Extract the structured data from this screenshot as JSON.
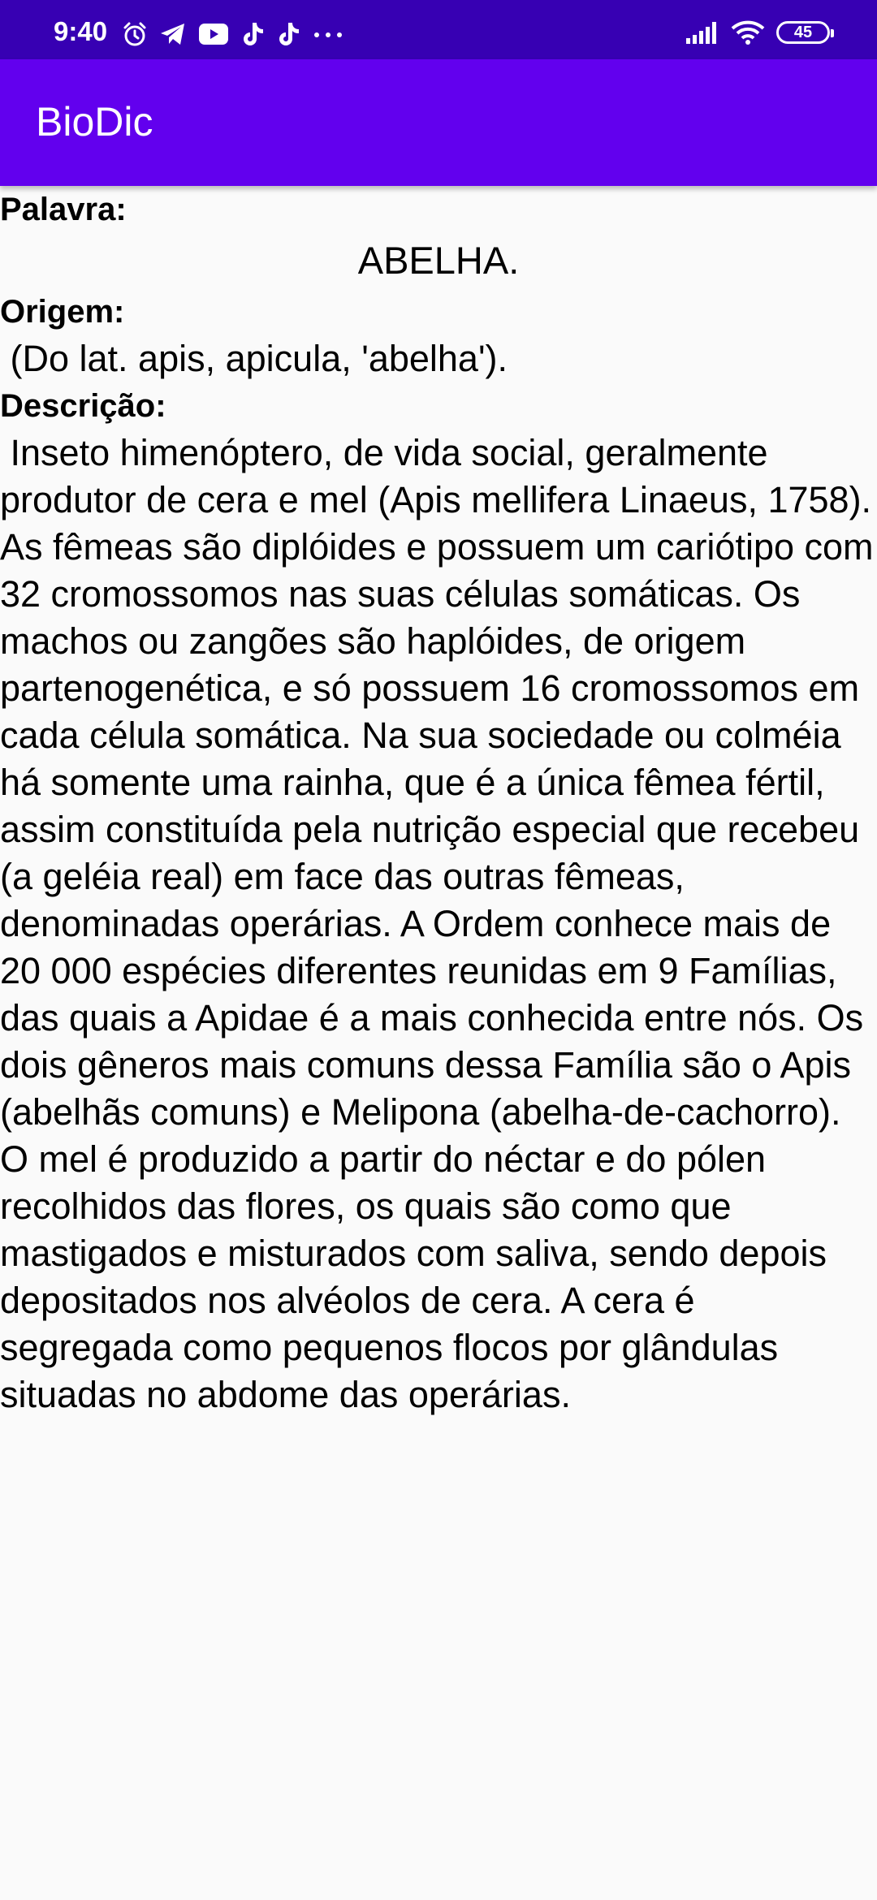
{
  "status_bar": {
    "time": "9:40",
    "battery": "45",
    "icons": [
      "alarm-icon",
      "telegram-icon",
      "youtube-icon",
      "tiktok-icon",
      "tiktok-icon",
      "more-icon",
      "signal-icon",
      "wifi-icon",
      "battery-icon"
    ]
  },
  "app_bar": {
    "title": "BioDic",
    "color": "#6200ee"
  },
  "entry": {
    "palavra_label": "Palavra:",
    "palavra": "ABELHA.",
    "origem_label": "Origem:",
    "origem": " (Do lat. apis, apicula, 'abelha').",
    "descricao_label": "Descrição:",
    "descricao": " Inseto himenóptero, de vida social, geralmente produtor de cera e mel (Apis mellifera Linaeus, 1758). As fêmeas são diplóides e possuem um cariótipo com 32 cromossomos nas suas células somáticas. Os machos ou zangões são haplóides, de origem partenogenética, e só possuem 16 cromossomos em cada célula somática. Na sua sociedade ou colméia há somente uma rainha, que é a única fêmea fértil, assim constituída pela nutrição especial que recebeu (a geléia real) em face das outras fêmeas, denominadas operárias. A Ordem conhece mais de 20 000 espécies diferentes reunidas em 9 Famílias, das quais a Apidae é a mais conhecida entre nós. Os dois gêneros mais comuns dessa Família são o Apis (abelhãs comuns) e Melipona (abelha-de-cachorro). O mel é produzido a partir do néctar e do pólen recolhidos das flores, os quais são como que mastigados e misturados com saliva, sendo depois depositados nos alvéolos de cera. A cera é segregada como pequenos flocos por glândulas situadas no abdome das operárias."
  }
}
